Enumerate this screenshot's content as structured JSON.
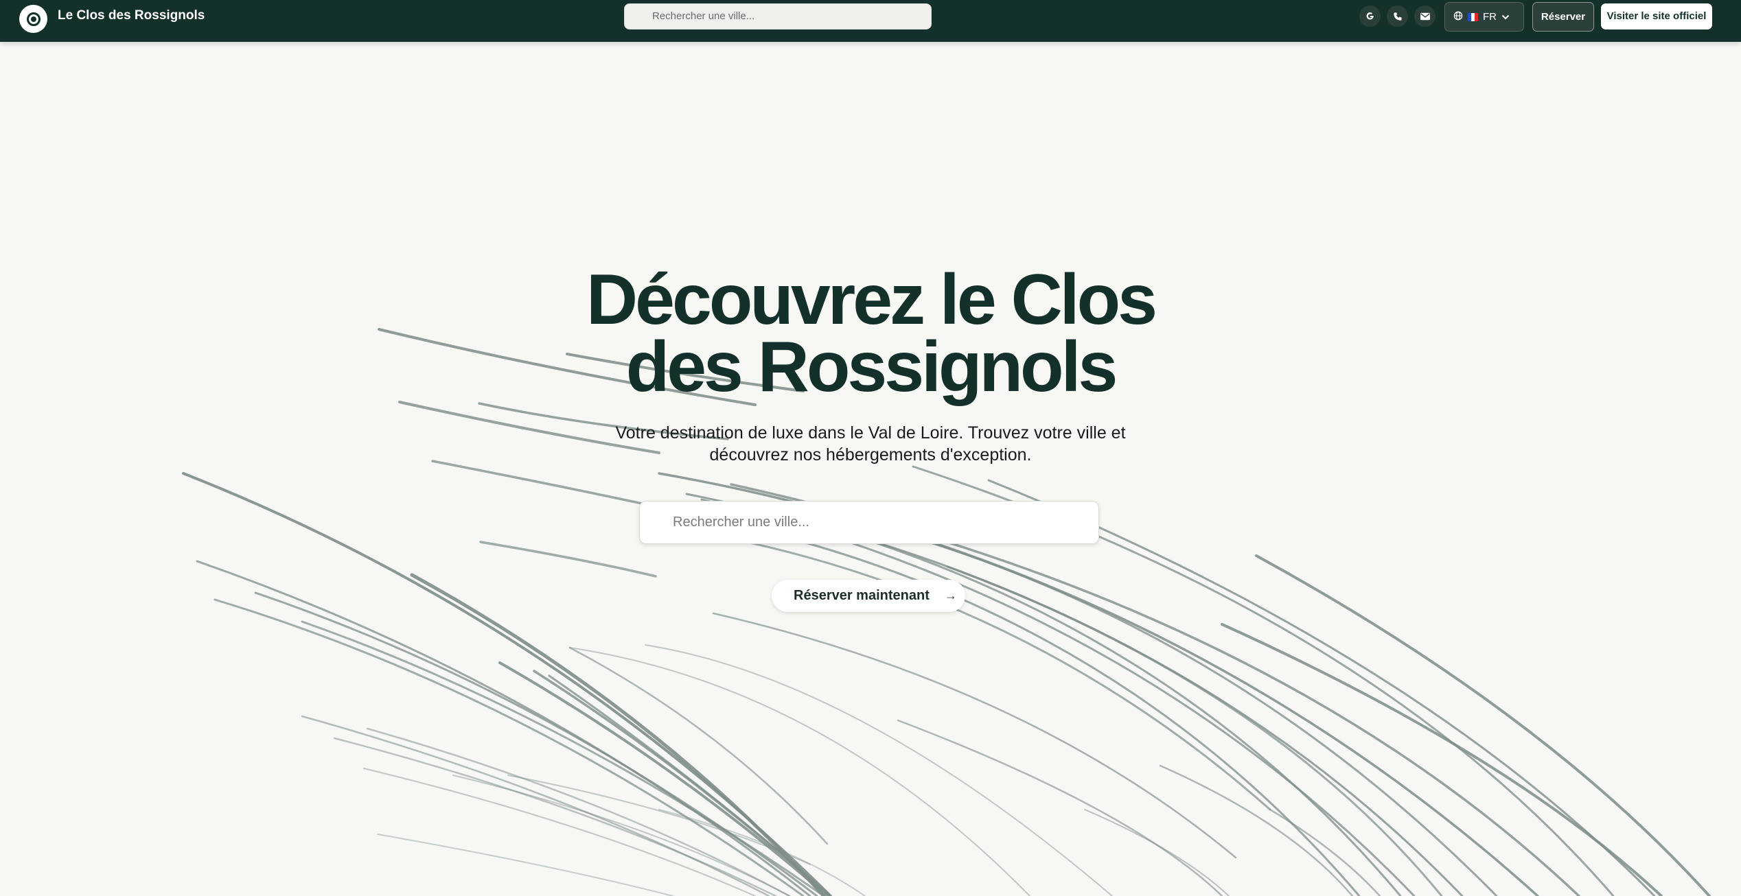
{
  "header": {
    "brand": "Le Clos des Rossignols",
    "search_placeholder": "Rechercher une ville...",
    "language": "FR",
    "reserve_label": "Réserver",
    "visit_label": "Visiter le site officiel"
  },
  "hero": {
    "title_line1": "Découvrez le Clos",
    "title_line2": "des Rossignols",
    "subtitle_line1": "Votre destination de luxe dans le Val de Loire. Trouvez votre ville et",
    "subtitle_line2": "découvrez nos hébergements d'exception.",
    "search_placeholder": "Rechercher une ville...",
    "cta_label": "Réserver maintenant",
    "cta_arrow": "→"
  },
  "colors": {
    "header_bg": "#14302b",
    "page_bg": "#f7f7f4",
    "title": "#14302b",
    "lines": "#7e8c86"
  },
  "icons": [
    "logo-icon",
    "google-icon",
    "phone-icon",
    "mail-icon",
    "globe-icon",
    "france-flag-icon",
    "chevron-down-icon",
    "arrow-right-icon"
  ]
}
